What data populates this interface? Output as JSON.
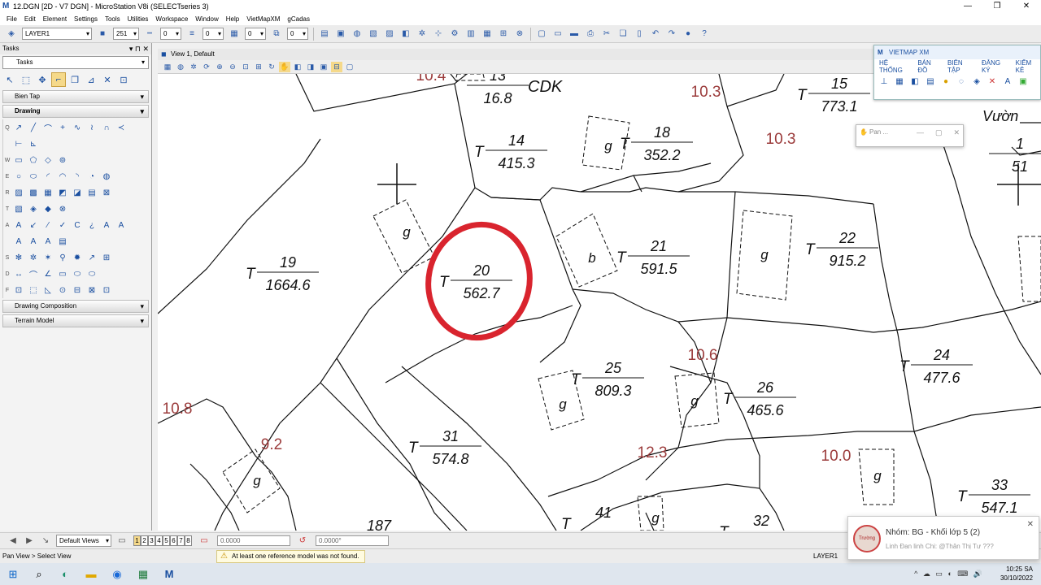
{
  "window": {
    "title": "12.DGN [2D - V7 DGN] - MicroStation V8i (SELECTseries 3)",
    "app_icon": "microstation-logo-icon",
    "controls": [
      "—",
      "❐",
      "✕"
    ]
  },
  "menu": [
    "File",
    "Edit",
    "Element",
    "Settings",
    "Tools",
    "Utilities",
    "Workspace",
    "Window",
    "Help",
    "VietMapXM",
    "gCadas"
  ],
  "toolbar": {
    "level": "LAYER1",
    "color": "251",
    "style": "0",
    "weight": "0",
    "transparency": "0",
    "priority": "0"
  },
  "tasks": {
    "title": "Tasks",
    "selected": "Tasks",
    "section_biendap": "Bien Tap",
    "section_drawing": "Drawing",
    "section_composition": "Drawing Composition",
    "section_terrain": "Terrain Model",
    "row_letters": [
      "Q",
      "W",
      "E",
      "R",
      "T",
      "A",
      "S",
      "D",
      "F"
    ]
  },
  "view": {
    "title": "View 1, Default"
  },
  "vietmap": {
    "title": "VIETMAP XM",
    "menu": [
      "HỆ THỐNG",
      "BẢN ĐỒ",
      "BIÊN TẬP",
      "ĐĂNG KÝ",
      "KIỂM KÊ"
    ]
  },
  "pan_window": {
    "title": "Pan ..."
  },
  "bottombar": {
    "views_label": "Default Views",
    "view_numbers": [
      "1",
      "2",
      "3",
      "4",
      "5",
      "6",
      "7",
      "8"
    ],
    "active_view": "1",
    "distance": "0.0000",
    "angle": "0.0000°"
  },
  "status": {
    "left": "Pan View > Select View",
    "message": "At least one reference model was not found.",
    "layer": "LAYER1"
  },
  "taskbar": {
    "time": "10:25 SA",
    "date": "30/10/2022",
    "tray_icons": "^ ☁ ▭ ◐ ⌨ 🔊"
  },
  "notification": {
    "title": "Nhóm: BG - Khối lớp 5 (2)",
    "body": "Linh Đan linh Chi: @Thân Thị Tư ???",
    "avatar_text": "Trường"
  },
  "map": {
    "parcels": [
      {
        "id": "13",
        "area": "16.8",
        "land_type": ""
      },
      {
        "id": "14",
        "area": "415.3",
        "land_type": "T"
      },
      {
        "id": "15",
        "area": "773.1",
        "land_type": "T"
      },
      {
        "id": "18",
        "area": "352.2",
        "land_type": "T"
      },
      {
        "id": "19",
        "area": "1664.6",
        "land_type": "T"
      },
      {
        "id": "20",
        "area": "562.7",
        "land_type": "T"
      },
      {
        "id": "21",
        "area": "591.5",
        "land_type": "T"
      },
      {
        "id": "22",
        "area": "915.2",
        "land_type": "T"
      },
      {
        "id": "24",
        "area": "477.6",
        "land_type": "T"
      },
      {
        "id": "25",
        "area": "809.3",
        "land_type": "T"
      },
      {
        "id": "26",
        "area": "465.6",
        "land_type": "T"
      },
      {
        "id": "31",
        "area": "574.8",
        "land_type": "T"
      },
      {
        "id": "33",
        "area": "547.1",
        "land_type": "T"
      },
      {
        "id": "41",
        "area": "",
        "land_type": "T"
      },
      {
        "id": "32",
        "area": "",
        "land_type": "T"
      },
      {
        "id": "187",
        "area": "",
        "land_type": ""
      },
      {
        "id": "1",
        "area": "51",
        "land_type": ""
      }
    ],
    "building_marks": [
      "g",
      "g",
      "b",
      "g",
      "g",
      "g",
      "g",
      "g",
      "g"
    ],
    "elevations": [
      "10.4",
      "10.3",
      "10.3",
      "10.6",
      "10.8",
      "9.2",
      "12.3",
      "10.0"
    ],
    "other_labels": [
      "CDK",
      "Vườn",
      "20"
    ],
    "highlight_color": "#d9242e",
    "elevation_color": "#9b3b3b"
  }
}
